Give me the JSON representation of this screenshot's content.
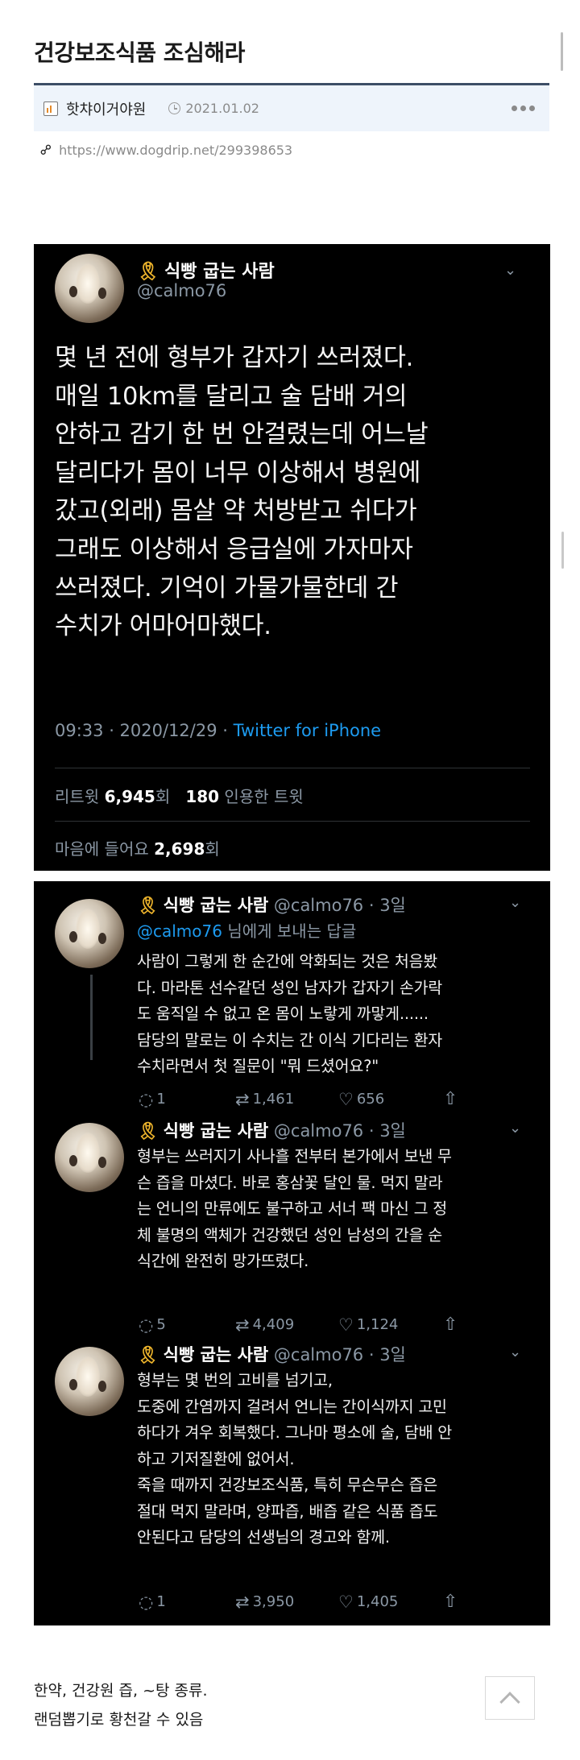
{
  "post": {
    "title": "건강보조식품 조심해라",
    "author": "핫챠이거야원",
    "date": "2021.01.02",
    "url": "https://www.dogdrip.net/299398653"
  },
  "main_tweet": {
    "ribbon": "🎗",
    "display_name": "식빵 굽는 사람",
    "handle": "@calmo76",
    "text": "몇 년 전에 형부가 갑자기 쓰러졌다.\n매일 10km를 달리고 술 담배 거의\n안하고 감기 한 번 안걸렸는데 어느날\n달리다가 몸이 너무 이상해서 병원에\n갔고(외래) 몸살 약 처방받고 쉬다가\n그래도 이상해서 응급실에 가자마자\n쓰러졌다. 기억이 가물가물한데 간\n수치가 어마어마했다.",
    "time": "09:33 · 2020/12/29 · ",
    "via": "Twitter for iPhone",
    "retweet_label": "리트윗 ",
    "retweet_count": "6,945",
    "retweet_unit": "회",
    "quote_count": "180",
    "quote_label": " 인용한 트윗",
    "like_label": "마음에 들어요 ",
    "like_count": "2,698",
    "like_unit": "회"
  },
  "replies": [
    {
      "display_name": "식빵 굽는 사람",
      "handle_age": " @calmo76 · 3일",
      "reply_mention": "@calmo76",
      "reply_suffix": " 님에게 보내는 답글",
      "text": "사람이 그렇게 한 순간에 악화되는 것은 처음봤\n다. 마라톤 선수같던 성인 남자가 갑자기 손가락\n도 움직일 수 없고 온 몸이 노랗게 까맣게......\n담당의 말로는 이 수치는 간 이식 기다리는 환자\n수치라면서 첫 질문이 \"뭐 드셨어요?\"",
      "replies": "1",
      "retweets": "1,461",
      "likes": "656"
    },
    {
      "display_name": "식빵 굽는 사람",
      "handle_age": " @calmo76 · 3일",
      "text": "형부는 쓰러지기 사나흘 전부터 본가에서 보낸 무\n슨 즙을 마셨다. 바로 홍삼꽃 달인 물. 먹지 말라\n는 언니의 만류에도 불구하고 서너 팩 마신 그 정\n체 불명의 액체가 건강했던 성인 남성의 간을 순\n식간에 완전히 망가뜨렸다.",
      "replies": "5",
      "retweets": "4,409",
      "likes": "1,124"
    },
    {
      "display_name": "식빵 굽는 사람",
      "handle_age": " @calmo76 · 3일",
      "text": "형부는 몇 번의 고비를 넘기고,\n도중에 간염까지 걸려서 언니는 간이식까지 고민\n하다가 겨우 회복했다. 그나마 평소에 술, 담배 안\n하고 기저질환에 없어서.\n죽을 때까지 건강보조식품, 특히 무슨무슨 즙은\n절대 먹지 말라며, 양파즙, 배즙 같은 식품 즙도\n안된다고 담당의 선생님의 경고와 함께.",
      "replies": "1",
      "retweets": "3,950",
      "likes": "1,405"
    }
  ],
  "footer": {
    "line1": "한약, 건강원 즙, ~탕 종류.",
    "line2": "랜덤뽑기로 황천갈 수 있음"
  },
  "icons": {
    "chevron": "⌄",
    "reply": "💬",
    "retweet": "⇄",
    "like": "♡",
    "share": "⇧",
    "link": "⚯"
  },
  "colors": {
    "tweet_bg": "#000000",
    "link_blue": "#1d9bf0",
    "meta_bar": "#eef4fb",
    "meta_border": "#3d4e66",
    "ribbon": "#f0b62c"
  }
}
